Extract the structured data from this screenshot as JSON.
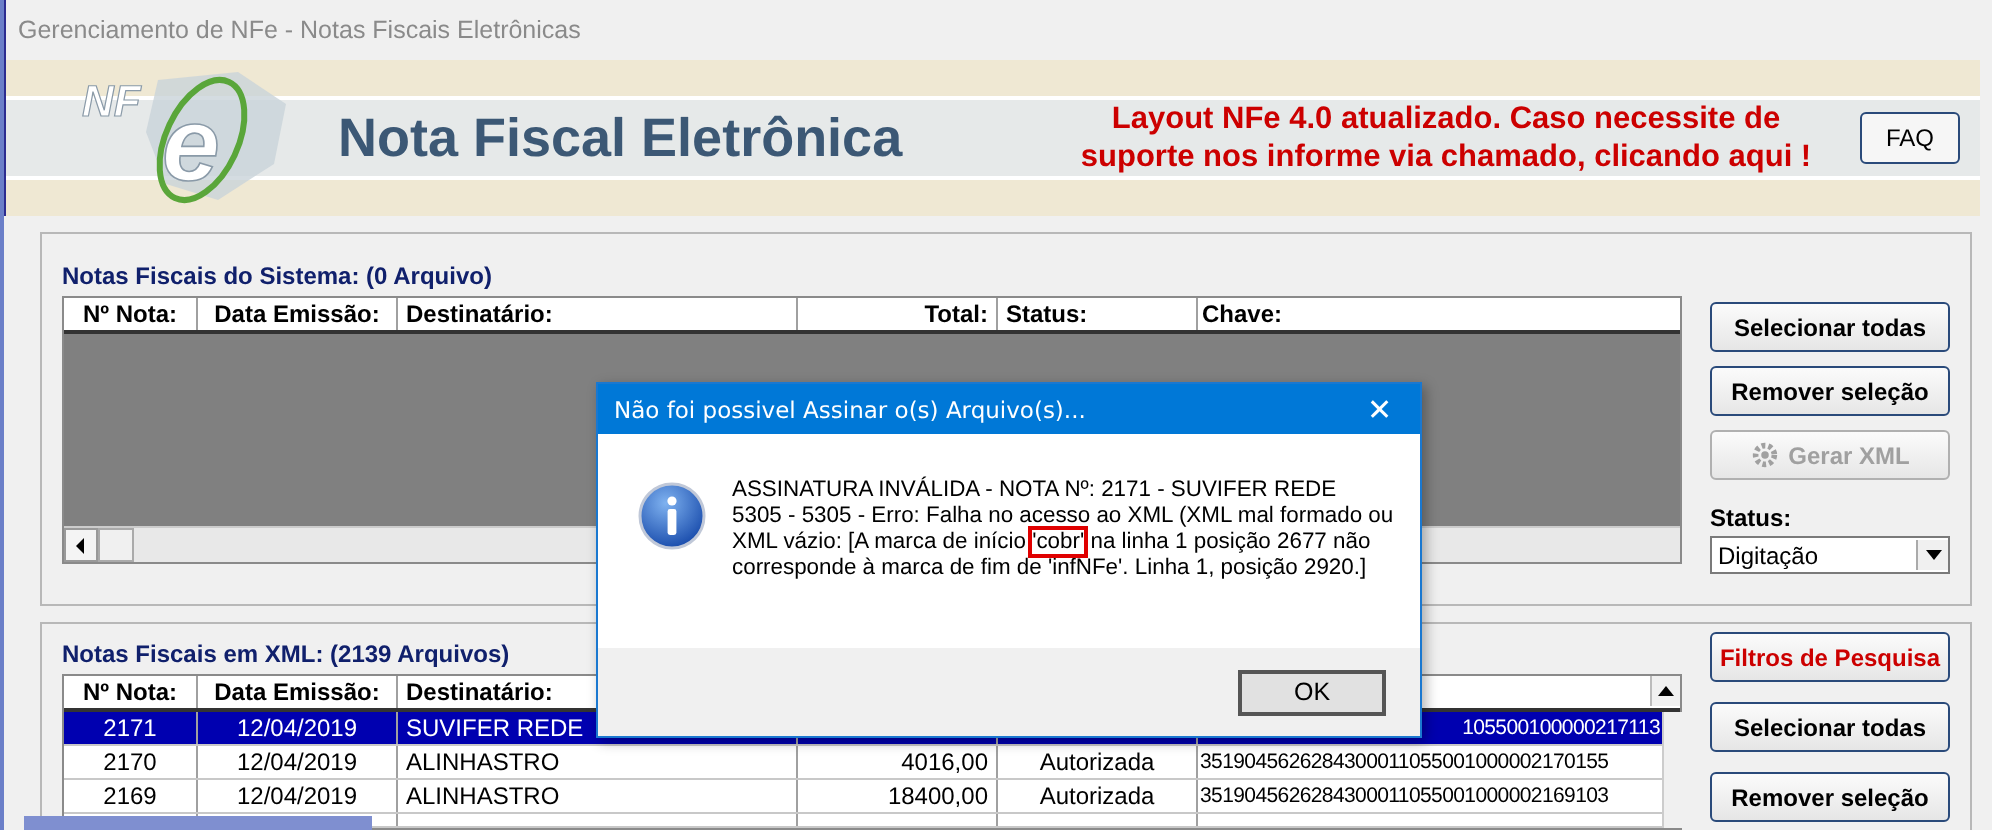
{
  "window": {
    "title": "Gerenciamento de NFe - Notas Fiscais Eletrônicas"
  },
  "banner": {
    "logo_text": "NF",
    "logo_letter": "e",
    "title": "Nota Fiscal Eletrônica",
    "notice": "Layout NFe 4.0 atualizado. Caso necessite de suporte nos informe via chamado, clicando aqui !",
    "faq_button": "FAQ"
  },
  "system_panel": {
    "title": "Notas Fiscais do Sistema: (0 Arquivo)",
    "columns": [
      "Nº Nota:",
      "Data Emissão:",
      "Destinatário:",
      "Total:",
      "Status:",
      "Chave:"
    ],
    "buttons": [
      {
        "label": "Selecionar todas",
        "disabled": false
      },
      {
        "label": "Remover seleção",
        "disabled": false
      },
      {
        "label": "Gerar XML",
        "disabled": true
      }
    ],
    "status_label": "Status:",
    "status_value": "Digitação"
  },
  "xml_panel": {
    "title": "Notas Fiscais em XML: (2139 Arquivos)",
    "columns": [
      "Nº Nota:",
      "Data Emissão:",
      "Destinatário:"
    ],
    "rows": [
      {
        "numero": "2171",
        "data": "12/04/2019",
        "destinatario": "SUVIFER REDE",
        "chave": "105500100000217113",
        "selected": true
      },
      {
        "numero": "2170",
        "data": "12/04/2019",
        "destinatario": "ALINHASTRO",
        "total": "4016,00",
        "status": "Autorizada",
        "chave": "3519045626284300011055001000002170155",
        "selected": false
      },
      {
        "numero": "2169",
        "data": "12/04/2019",
        "destinatario": "ALINHASTRO",
        "total": "18400,00",
        "status": "Autorizada",
        "chave": "3519045626284300011055001000002169103",
        "selected": false
      }
    ],
    "buttons": [
      {
        "label": "Filtros de Pesquisa",
        "kind": "filter"
      },
      {
        "label": "Selecionar todas",
        "kind": "normal"
      },
      {
        "label": "Remover seleção",
        "kind": "normal"
      }
    ]
  },
  "dialog": {
    "title": "Não foi possivel Assinar o(s) Arquivo(s)...",
    "close": "✕",
    "message_before": "ASSINATURA INVÁLIDA - NOTA Nº: 2171 - SUVIFER REDE\n5305 - 5305 - Erro: Falha no acesso ao XML (XML mal formado ou XML vázio: [A marca de início ",
    "message_highlight": "'cobr'",
    "message_after": " na linha 1 posição 2677 não corresponde à marca de fim de 'infNFe'. Linha 1, posição 2920.]",
    "ok_button": "OK"
  }
}
